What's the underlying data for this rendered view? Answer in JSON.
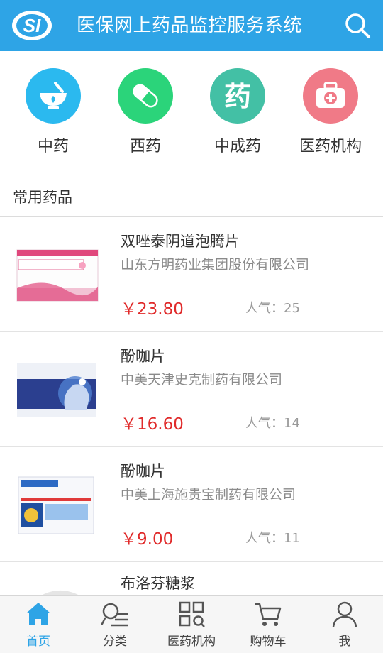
{
  "header": {
    "title": "医保网上药品监控服务系统",
    "logo_icon": "si-logo-icon",
    "search_icon": "search-icon"
  },
  "categories": [
    {
      "label": "中药",
      "icon": "mortar-icon",
      "color": "#2bb9ef"
    },
    {
      "label": "西药",
      "icon": "capsule-icon",
      "color": "#2bd47a"
    },
    {
      "label": "中成药",
      "icon": "yao-character-icon",
      "color": "#43c0a5"
    },
    {
      "label": "医药机构",
      "icon": "medical-kit-icon",
      "color": "#f07a87"
    }
  ],
  "section": {
    "title": "常用药品"
  },
  "products": [
    {
      "name": "双唑泰阴道泡腾片",
      "maker": "山东方明药业集团股份有限公司",
      "price": "￥23.80",
      "popularity": "人气：25"
    },
    {
      "name": "酚咖片",
      "maker": "中美天津史克制药有限公司",
      "price": "￥16.60",
      "popularity": "人气：14"
    },
    {
      "name": "酚咖片",
      "maker": "中美上海施贵宝制药有限公司",
      "price": "￥9.00",
      "popularity": "人气：11"
    },
    {
      "name": "布洛芬糖浆"
    }
  ],
  "tabbar": [
    {
      "label": "首页",
      "icon": "home-icon",
      "active": true
    },
    {
      "label": "分类",
      "icon": "category-icon",
      "active": false
    },
    {
      "label": "医药机构",
      "icon": "grid-icon",
      "active": false
    },
    {
      "label": "购物车",
      "icon": "cart-icon",
      "active": false
    },
    {
      "label": "我",
      "icon": "user-icon",
      "active": false
    }
  ],
  "colors": {
    "primary": "#2ea4e6",
    "price": "#e02b2b"
  }
}
